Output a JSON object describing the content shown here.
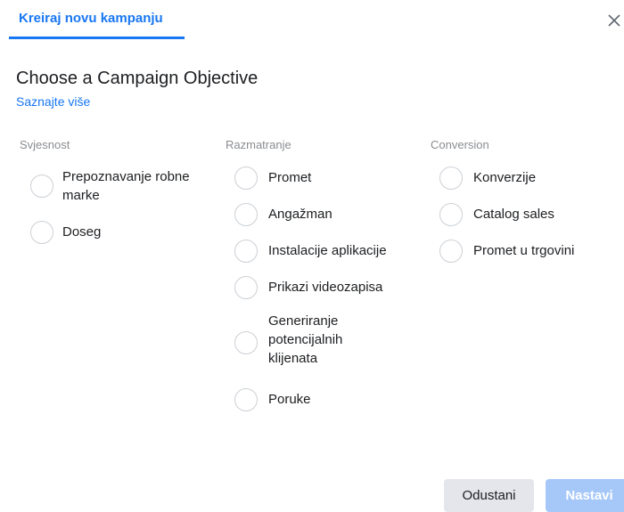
{
  "header": {
    "tab_label": "Kreiraj novu kampanju",
    "close_icon": "close-icon"
  },
  "main": {
    "title": "Choose a Campaign Objective",
    "learn_more": "Saznajte više"
  },
  "columns": [
    {
      "heading": "Svjesnost",
      "options": [
        "Prepoznavanje robne marke",
        "Doseg"
      ]
    },
    {
      "heading": "Razmatranje",
      "options": [
        "Promet",
        "Angažman",
        "Instalacije aplikacije",
        "Prikazi videozapisa",
        "Generiranje potencijalnih klijenata",
        "Poruke"
      ]
    },
    {
      "heading": "Conversion",
      "options": [
        "Konverzije",
        "Catalog sales",
        "Promet u trgovini"
      ]
    }
  ],
  "footer": {
    "cancel_label": "Odustani",
    "next_label": "Nastavi"
  },
  "colors": {
    "accent": "#1877f2",
    "next_disabled": "#a6c8f9"
  }
}
